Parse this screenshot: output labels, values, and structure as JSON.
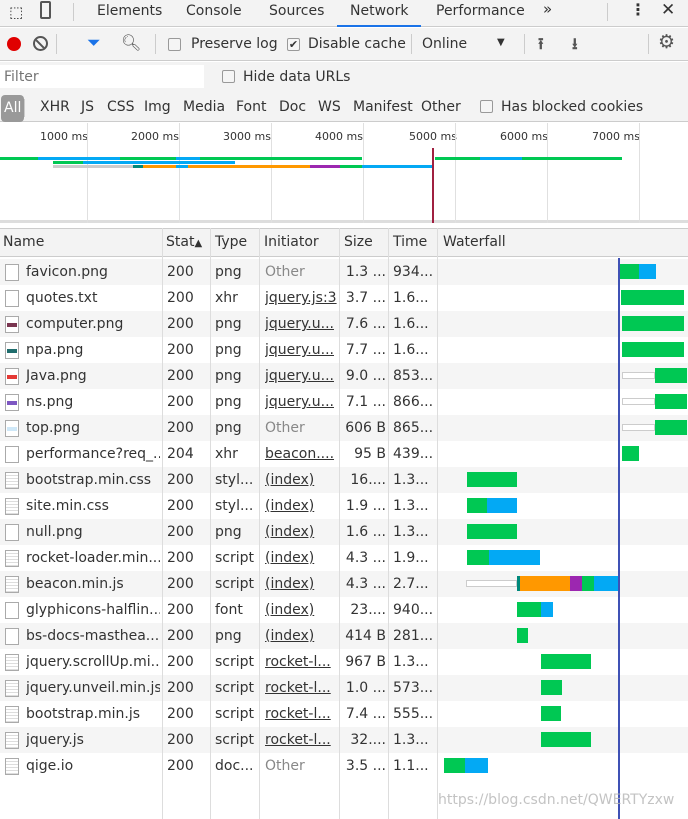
{
  "tabs": [
    "Elements",
    "Console",
    "Sources",
    "Network",
    "Performance"
  ],
  "active_tab": "Network",
  "toolbar": {
    "preserve_log": "Preserve log",
    "preserve_log_checked": false,
    "disable_cache": "Disable cache",
    "disable_cache_checked": true,
    "throttle": "Online"
  },
  "filter": {
    "placeholder": "Filter",
    "hide_data_urls": "Hide data URLs"
  },
  "types": [
    "All",
    "XHR",
    "JS",
    "CSS",
    "Img",
    "Media",
    "Font",
    "Doc",
    "WS",
    "Manifest",
    "Other"
  ],
  "has_blocked_cookies": "Has blocked cookies",
  "ticks": [
    "1000 ms",
    "2000 ms",
    "3000 ms",
    "4000 ms",
    "5000 ms",
    "6000 ms",
    "7000 ms"
  ],
  "columns": [
    "Name",
    "Stat",
    "Type",
    "Initiator",
    "Size",
    "Time",
    "Waterfall"
  ],
  "rows": [
    {
      "name": "favicon.png",
      "status": "200",
      "type": "png",
      "initiator": "Other",
      "size": "1.3 ...",
      "time": "934..."
    },
    {
      "name": "quotes.txt",
      "status": "200",
      "type": "xhr",
      "initiator": "jquery.js:3",
      "size": "3.7 ...",
      "time": "1.6..."
    },
    {
      "name": "computer.png",
      "status": "200",
      "type": "png",
      "initiator": "jquery.u...",
      "size": "7.6 ...",
      "time": "1.6..."
    },
    {
      "name": "npa.png",
      "status": "200",
      "type": "png",
      "initiator": "jquery.u...",
      "size": "7.7 ...",
      "time": "1.6..."
    },
    {
      "name": "Java.png",
      "status": "200",
      "type": "png",
      "initiator": "jquery.u...",
      "size": "9.0 ...",
      "time": "853..."
    },
    {
      "name": "ns.png",
      "status": "200",
      "type": "png",
      "initiator": "jquery.u...",
      "size": "7.1 ...",
      "time": "866..."
    },
    {
      "name": "top.png",
      "status": "200",
      "type": "png",
      "initiator": "Other",
      "size": "606 B",
      "time": "865..."
    },
    {
      "name": "performance?req_...",
      "status": "204",
      "type": "xhr",
      "initiator": "beacon....",
      "size": "95 B",
      "time": "439..."
    },
    {
      "name": "bootstrap.min.css",
      "status": "200",
      "type": "styl...",
      "initiator": "(index)",
      "size": "16....",
      "time": "1.3..."
    },
    {
      "name": "site.min.css",
      "status": "200",
      "type": "styl...",
      "initiator": "(index)",
      "size": "1.9 ...",
      "time": "1.3..."
    },
    {
      "name": "null.png",
      "status": "200",
      "type": "png",
      "initiator": "(index)",
      "size": "1.6 ...",
      "time": "1.3..."
    },
    {
      "name": "rocket-loader.min...",
      "status": "200",
      "type": "script",
      "initiator": "(index)",
      "size": "4.3 ...",
      "time": "1.9..."
    },
    {
      "name": "beacon.min.js",
      "status": "200",
      "type": "script",
      "initiator": "(index)",
      "size": "4.3 ...",
      "time": "2.7..."
    },
    {
      "name": "glyphicons-halflin...",
      "status": "200",
      "type": "font",
      "initiator": "(index)",
      "size": "23....",
      "time": "940..."
    },
    {
      "name": "bs-docs-masthea...",
      "status": "200",
      "type": "png",
      "initiator": "(index)",
      "size": "414 B",
      "time": "281..."
    },
    {
      "name": "jquery.scrollUp.mi...",
      "status": "200",
      "type": "script",
      "initiator": "rocket-l...",
      "size": "967 B",
      "time": "1.3..."
    },
    {
      "name": "jquery.unveil.min.js",
      "status": "200",
      "type": "script",
      "initiator": "rocket-l...",
      "size": "1.0 ...",
      "time": "573..."
    },
    {
      "name": "bootstrap.min.js",
      "status": "200",
      "type": "script",
      "initiator": "rocket-l...",
      "size": "7.4 ...",
      "time": "555..."
    },
    {
      "name": "jquery.js",
      "status": "200",
      "type": "script",
      "initiator": "rocket-l...",
      "size": "32....",
      "time": "1.3..."
    },
    {
      "name": "qige.io",
      "status": "200",
      "type": "doc...",
      "initiator": "Other",
      "size": "3.5 ...",
      "time": "1.1..."
    }
  ],
  "watermark": "https://blog.csdn.net/QWERTYzxw",
  "colors": {
    "waiting": "#00c853",
    "download": "#03a9f4",
    "ssl": "#ff9800",
    "connect": "#9c27b0",
    "accent": "#1a73e8",
    "record": "#e00000"
  }
}
